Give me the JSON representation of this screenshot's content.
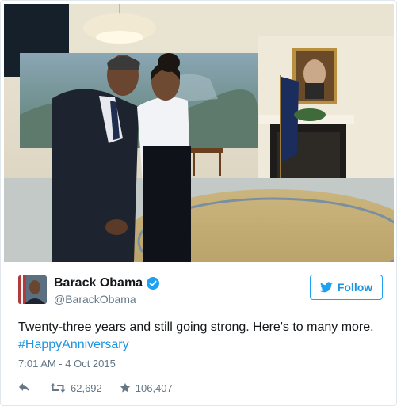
{
  "tweet": {
    "author": {
      "name": "Barack Obama",
      "handle": "@BarackObama",
      "verified": true
    },
    "follow_label": "Follow",
    "text": "Twenty-three years and still going strong. Here's to many more.",
    "hashtag": "#HappyAnniversary",
    "timestamp": "7:01 AM - 4 Oct 2015",
    "retweets": "62,692",
    "likes": "106,407"
  },
  "photo": {
    "subject": "couple-portrait-in-diplomatic-room"
  },
  "colors": {
    "accent": "#1da1f2",
    "link": "#1b95e0",
    "secondary_text": "#657786",
    "border": "#e1e8ed"
  },
  "icons": {
    "verified": "verified-badge-icon",
    "follow": "twitter-bird-icon",
    "reply": "reply-icon",
    "retweet": "retweet-icon",
    "like": "star-icon"
  }
}
